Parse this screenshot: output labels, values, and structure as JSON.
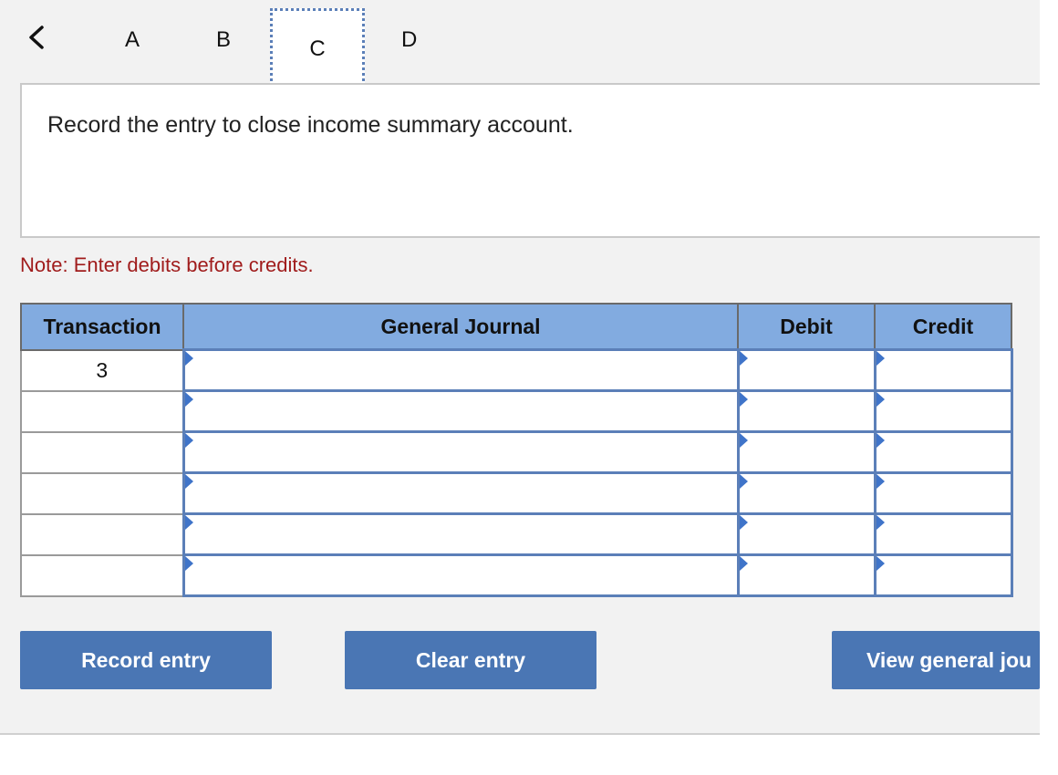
{
  "nav": {
    "back_icon": "chevron-left-icon",
    "tabs": [
      {
        "label": "A"
      },
      {
        "label": "B"
      },
      {
        "label": "C",
        "active": true
      },
      {
        "label": "D"
      }
    ]
  },
  "question": {
    "text": "Record the entry to close income summary account."
  },
  "note": "Note: Enter debits before credits.",
  "journal": {
    "headers": [
      "Transaction",
      "General Journal",
      "Debit",
      "Credit"
    ],
    "rows": [
      {
        "transaction": "3",
        "account": "",
        "debit": "",
        "credit": ""
      },
      {
        "transaction": "",
        "account": "",
        "debit": "",
        "credit": ""
      },
      {
        "transaction": "",
        "account": "",
        "debit": "",
        "credit": ""
      },
      {
        "transaction": "",
        "account": "",
        "debit": "",
        "credit": ""
      },
      {
        "transaction": "",
        "account": "",
        "debit": "",
        "credit": ""
      },
      {
        "transaction": "",
        "account": "",
        "debit": "",
        "credit": ""
      }
    ]
  },
  "buttons": {
    "record": "Record entry",
    "clear": "Clear entry",
    "view": "View general jou"
  },
  "colors": {
    "header_bg": "#82abe0",
    "button_bg": "#4a76b4",
    "input_border": "#5b7fb8",
    "note_text": "#a01c1c"
  }
}
